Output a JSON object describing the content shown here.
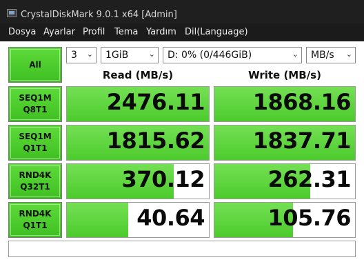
{
  "window": {
    "title": "CrystalDiskMark 9.0.1 x64 [Admin]"
  },
  "menu": {
    "items": [
      "Dosya",
      "Ayarlar",
      "Profil",
      "Tema",
      "Yardım",
      "Dil(Language)"
    ]
  },
  "controls": {
    "all_button": "All",
    "count": "3",
    "size": "1GiB",
    "drive": "D: 0% (0/446GiB)",
    "unit": "MB/s"
  },
  "headers": {
    "read": "Read (MB/s)",
    "write": "Write (MB/s)"
  },
  "tests": [
    {
      "line1": "SEQ1M",
      "line2": "Q8T1",
      "read": "2476.11",
      "write": "1868.16",
      "read_fill": 1.0,
      "write_fill": 1.0
    },
    {
      "line1": "SEQ1M",
      "line2": "Q1T1",
      "read": "1815.62",
      "write": "1837.71",
      "read_fill": 1.0,
      "write_fill": 1.0
    },
    {
      "line1": "RND4K",
      "line2": "Q32T1",
      "read": "370.12",
      "write": "262.31",
      "read_fill": 0.75,
      "write_fill": 0.68
    },
    {
      "line1": "RND4K",
      "line2": "Q1T1",
      "read": "40.64",
      "write": "105.76",
      "read_fill": 0.43,
      "write_fill": 0.56
    }
  ],
  "status": {
    "text": ""
  },
  "colors": {
    "accent_green": "#4ccb2c",
    "titlebar": "#1f1f1f"
  }
}
